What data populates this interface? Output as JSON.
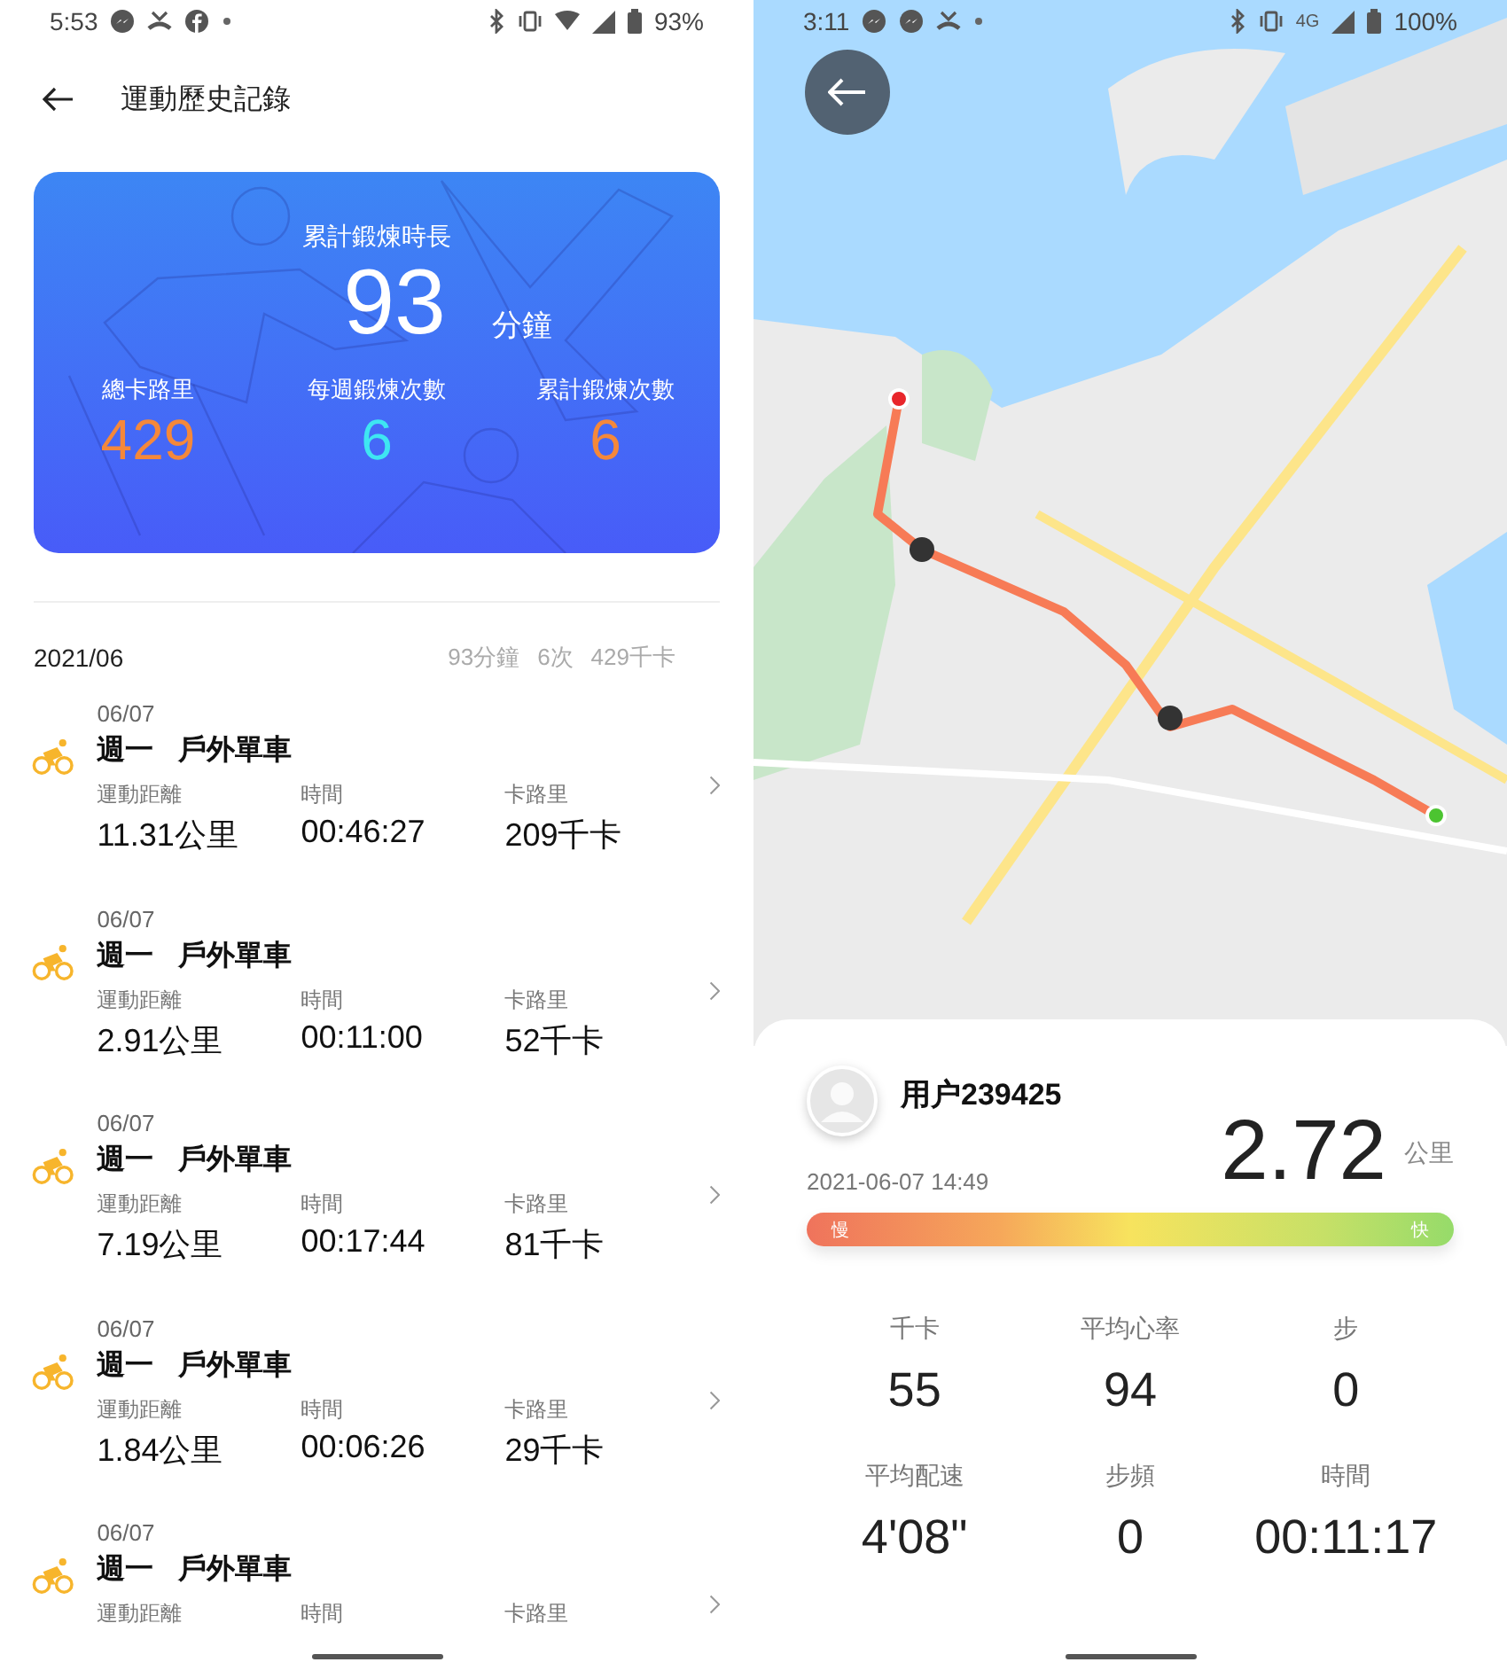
{
  "left_screen": {
    "status_bar": {
      "time": "5:53",
      "battery": "93%"
    },
    "header": {
      "title": "運動歷史記錄"
    },
    "summary_card": {
      "title": "累計鍛煉時長",
      "value": "93",
      "unit": "分鐘",
      "stats": [
        {
          "label": "總卡路里",
          "value": "429",
          "color": "#f5883a"
        },
        {
          "label": "每週鍛煉次數",
          "value": "6",
          "color": "#3ee6f2"
        },
        {
          "label": "累計鍛煉次數",
          "value": "6",
          "color": "#f5883a"
        }
      ]
    },
    "month": {
      "label": "2021/06",
      "minutes": "93分鐘",
      "count": "6次",
      "calories": "429千卡"
    },
    "records": [
      {
        "date": "06/07",
        "weekday": "週一",
        "activity": "戶外單車",
        "metrics": [
          {
            "label": "運動距離",
            "value": "11.31公里"
          },
          {
            "label": "時間",
            "value": "00:46:27"
          },
          {
            "label": "卡路里",
            "value": "209千卡"
          }
        ]
      },
      {
        "date": "06/07",
        "weekday": "週一",
        "activity": "戶外單車",
        "metrics": [
          {
            "label": "運動距離",
            "value": "2.91公里"
          },
          {
            "label": "時間",
            "value": "00:11:00"
          },
          {
            "label": "卡路里",
            "value": "52千卡"
          }
        ]
      },
      {
        "date": "06/07",
        "weekday": "週一",
        "activity": "戶外單車",
        "metrics": [
          {
            "label": "運動距離",
            "value": "7.19公里"
          },
          {
            "label": "時間",
            "value": "00:17:44"
          },
          {
            "label": "卡路里",
            "value": "81千卡"
          }
        ]
      },
      {
        "date": "06/07",
        "weekday": "週一",
        "activity": "戶外單車",
        "metrics": [
          {
            "label": "運動距離",
            "value": "1.84公里"
          },
          {
            "label": "時間",
            "value": "00:06:26"
          },
          {
            "label": "卡路里",
            "value": "29千卡"
          }
        ]
      },
      {
        "date": "06/07",
        "weekday": "週一",
        "activity": "戶外單車",
        "metrics": [
          {
            "label": "運動距離"
          },
          {
            "label": "時間"
          },
          {
            "label": "卡路里"
          }
        ]
      }
    ]
  },
  "right_screen": {
    "status_bar": {
      "time": "3:11",
      "network": "4G",
      "battery": "100%"
    },
    "summary": {
      "user": "用户239425",
      "datetime": "2021-06-07 14:49",
      "distance": "2.72",
      "unit": "公里",
      "pace_bar": {
        "slow_label": "慢",
        "fast_label": "快"
      },
      "stats": [
        {
          "label": "千卡",
          "value": "55"
        },
        {
          "label": "平均心率",
          "value": "94"
        },
        {
          "label": "步",
          "value": "0"
        },
        {
          "label": "平均配速",
          "value": "4'08\""
        },
        {
          "label": "步頻",
          "value": "0"
        },
        {
          "label": "時間",
          "value": "00:11:17"
        }
      ]
    }
  }
}
